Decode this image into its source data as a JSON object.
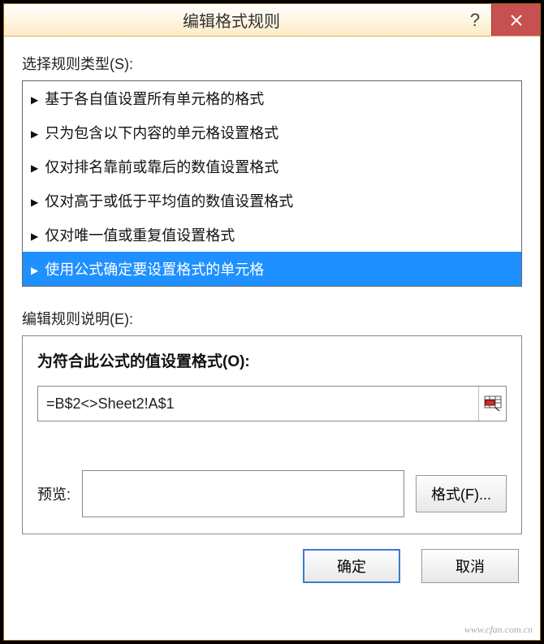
{
  "window": {
    "title": "编辑格式规则",
    "help_tooltip": "帮助",
    "close_tooltip": "关闭"
  },
  "select_rule_type": {
    "label": "选择规则类型(S):",
    "items": [
      "基于各自值设置所有单元格的格式",
      "只为包含以下内容的单元格设置格式",
      "仅对排名靠前或靠后的数值设置格式",
      "仅对高于或低于平均值的数值设置格式",
      "仅对唯一值或重复值设置格式",
      "使用公式确定要设置格式的单元格"
    ],
    "selected_index": 5
  },
  "edit_rule_desc": {
    "label": "编辑规则说明(E):",
    "sub_label": "为符合此公式的值设置格式(O):",
    "formula_value": "=B$2<>Sheet2!A$1",
    "preview_label": "预览:",
    "format_button": "格式(F)..."
  },
  "footer": {
    "ok": "确定",
    "cancel": "取消"
  },
  "watermark": "www.cfan.com.cn"
}
